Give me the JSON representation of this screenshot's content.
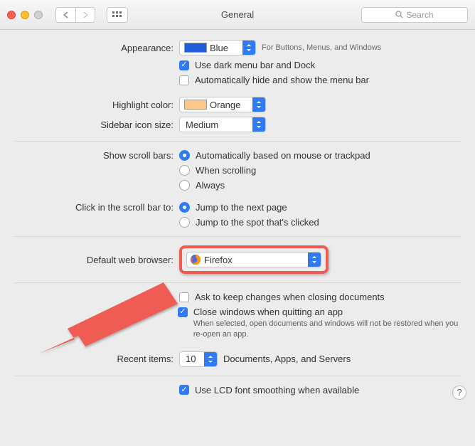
{
  "titlebar": {
    "title": "General",
    "search_placeholder": "Search"
  },
  "appearance": {
    "label": "Appearance:",
    "value": "Blue",
    "swatch": "#1c5fd8",
    "hint": "For Buttons, Menus, and Windows",
    "dark_menu": "Use dark menu bar and Dock",
    "auto_hide": "Automatically hide and show the menu bar"
  },
  "highlight": {
    "label": "Highlight color:",
    "value": "Orange",
    "swatch": "#fcc88a"
  },
  "sidebar_size": {
    "label": "Sidebar icon size:",
    "value": "Medium"
  },
  "scroll": {
    "label": "Show scroll bars:",
    "opts": [
      "Automatically based on mouse or trackpad",
      "When scrolling",
      "Always"
    ]
  },
  "click_scroll": {
    "label": "Click in the scroll bar to:",
    "opts": [
      "Jump to the next page",
      "Jump to the spot that's clicked"
    ]
  },
  "browser": {
    "label": "Default web browser:",
    "value": "Firefox"
  },
  "docs": {
    "ask": "Ask to keep changes when closing documents",
    "close": "Close windows when quitting an app",
    "hint": "When selected, open documents and windows will not be restored when you re-open an app."
  },
  "recent": {
    "label": "Recent items:",
    "value": "10",
    "suffix": "Documents, Apps, and Servers"
  },
  "lcd": {
    "label": "Use LCD font smoothing when available"
  },
  "help": "?"
}
